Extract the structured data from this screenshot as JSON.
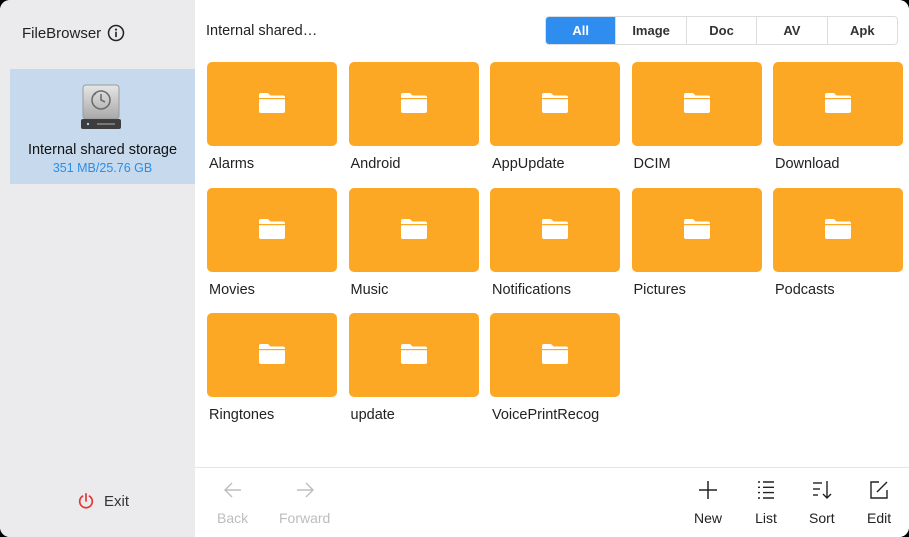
{
  "app": {
    "title": "FileBrowser"
  },
  "sidebar": {
    "storage": {
      "name": "Internal shared storage",
      "size": "351 MB/25.76 GB"
    },
    "exit_label": "Exit"
  },
  "header": {
    "path": "Internal shared…",
    "filters": [
      {
        "label": "All",
        "active": true
      },
      {
        "label": "Image",
        "active": false
      },
      {
        "label": "Doc",
        "active": false
      },
      {
        "label": "AV",
        "active": false
      },
      {
        "label": "Apk",
        "active": false
      }
    ]
  },
  "folders": [
    {
      "name": "Alarms"
    },
    {
      "name": "Android"
    },
    {
      "name": "AppUpdate"
    },
    {
      "name": "DCIM"
    },
    {
      "name": "Download"
    },
    {
      "name": "Movies"
    },
    {
      "name": "Music"
    },
    {
      "name": "Notifications"
    },
    {
      "name": "Pictures"
    },
    {
      "name": "Podcasts"
    },
    {
      "name": "Ringtones"
    },
    {
      "name": "update"
    },
    {
      "name": "VoicePrintRecog"
    }
  ],
  "toolbar": {
    "back_label": "Back",
    "forward_label": "Forward",
    "new_label": "New",
    "list_label": "List",
    "sort_label": "Sort",
    "edit_label": "Edit"
  },
  "colors": {
    "folder": "#fda825",
    "accent": "#2f8df0",
    "sidebar_bg": "#ebebed",
    "selected_bg": "#c7d9ec",
    "power_red": "#e53935"
  },
  "icons": {
    "info": "info-circle-icon",
    "drive": "hard-drive-icon",
    "folder": "folder-icon",
    "power": "power-icon",
    "back": "arrow-left-icon",
    "forward": "arrow-right-icon",
    "new": "plus-icon",
    "list": "list-icon",
    "sort": "sort-icon",
    "edit": "edit-icon"
  }
}
